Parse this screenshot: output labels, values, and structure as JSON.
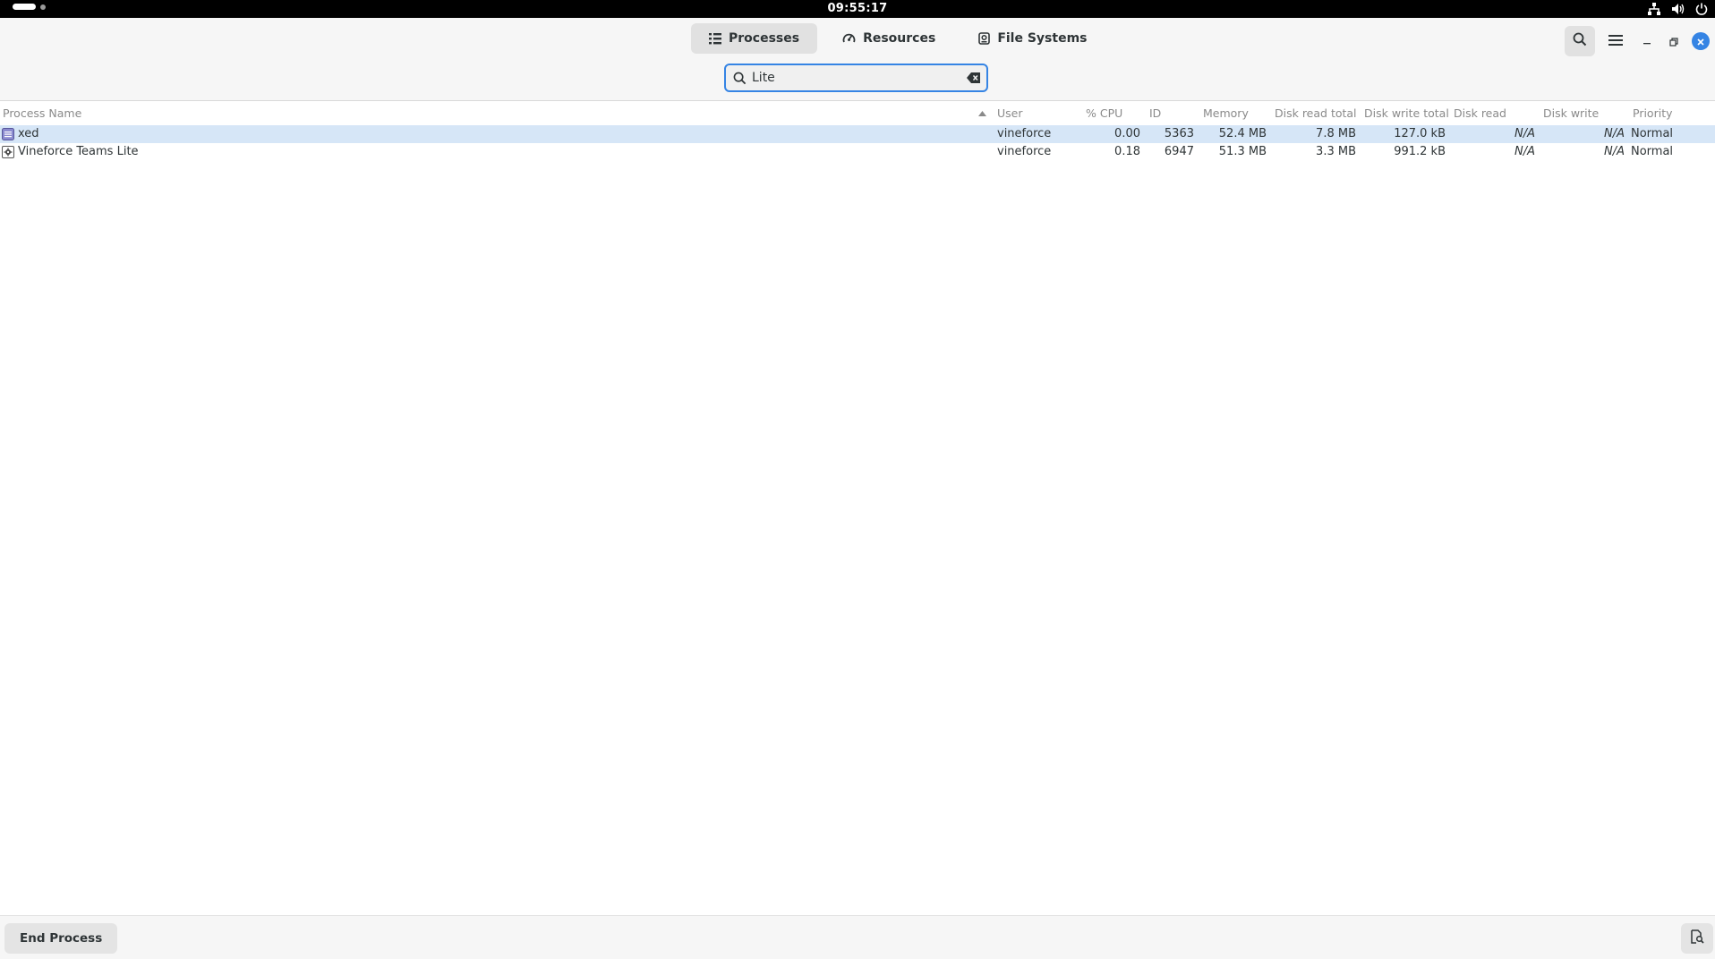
{
  "system_bar": {
    "time": "09:55:17"
  },
  "header": {
    "tabs": [
      {
        "label": "Processes",
        "icon": "list-icon",
        "active": true
      },
      {
        "label": "Resources",
        "icon": "gauge-icon",
        "active": false
      },
      {
        "label": "File Systems",
        "icon": "disk-icon",
        "active": false
      }
    ]
  },
  "search": {
    "value": "Lite"
  },
  "table": {
    "columns": [
      "Process Name",
      "User",
      "% CPU",
      "ID",
      "Memory",
      "Disk read total",
      "Disk write total",
      "Disk read",
      "Disk write",
      "Priority"
    ],
    "rows": [
      {
        "name": "xed",
        "user": "vineforce",
        "cpu": "0.00",
        "id": "5363",
        "memory": "52.4 MB",
        "disk_read_total": "7.8 MB",
        "disk_write_total": "127.0 kB",
        "disk_read": "N/A",
        "disk_write": "N/A",
        "priority": "Normal",
        "selected": true
      },
      {
        "name": "Vineforce Teams Lite",
        "user": "vineforce",
        "cpu": "0.18",
        "id": "6947",
        "memory": "51.3 MB",
        "disk_read_total": "3.3 MB",
        "disk_write_total": "991.2 kB",
        "disk_read": "N/A",
        "disk_write": "N/A",
        "priority": "Normal",
        "selected": false
      }
    ]
  },
  "footer": {
    "end_process_label": "End Process"
  }
}
